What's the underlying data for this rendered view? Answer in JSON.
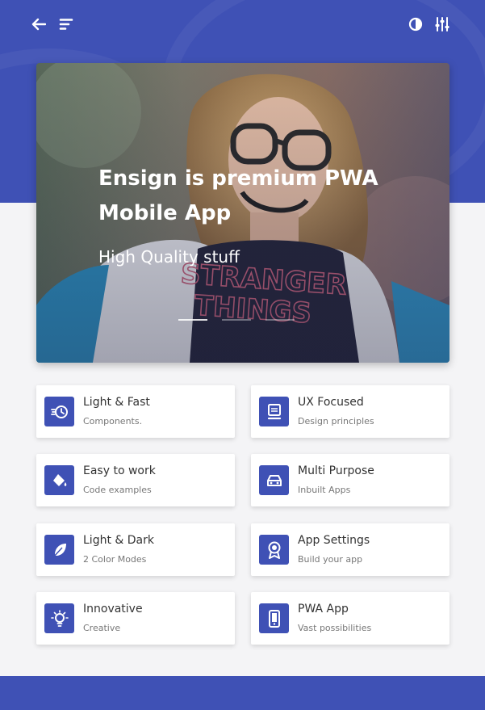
{
  "header": {
    "back_icon": "arrow-left-icon",
    "menu_icon": "menu-icon",
    "theme_icon": "contrast-icon",
    "settings_icon": "sliders-icon"
  },
  "hero": {
    "title": "Ensign is premium PWA Mobile App",
    "subtitle": "High Quality stuff",
    "slides": 3,
    "active_slide": 1
  },
  "features": [
    {
      "title": "Light & Fast",
      "subtitle": "Components.",
      "icon": "speed-clock-icon"
    },
    {
      "title": "UX Focused",
      "subtitle": "Design principles",
      "icon": "monitor-icon"
    },
    {
      "title": "Easy to work",
      "subtitle": "Code examples",
      "icon": "paint-bucket-icon"
    },
    {
      "title": "Multi Purpose",
      "subtitle": "Inbuilt Apps",
      "icon": "car-icon"
    },
    {
      "title": "Light & Dark",
      "subtitle": "2 Color Modes",
      "icon": "feather-icon"
    },
    {
      "title": "App Settings",
      "subtitle": "Build your app",
      "icon": "award-icon"
    },
    {
      "title": "Innovative",
      "subtitle": "Creative",
      "icon": "lightbulb-icon"
    },
    {
      "title": "PWA App",
      "subtitle": "Vast possibilities",
      "icon": "smartphone-icon"
    }
  ],
  "colors": {
    "primary": "#3f51b5",
    "background": "#f4f4f6",
    "card": "#ffffff"
  }
}
